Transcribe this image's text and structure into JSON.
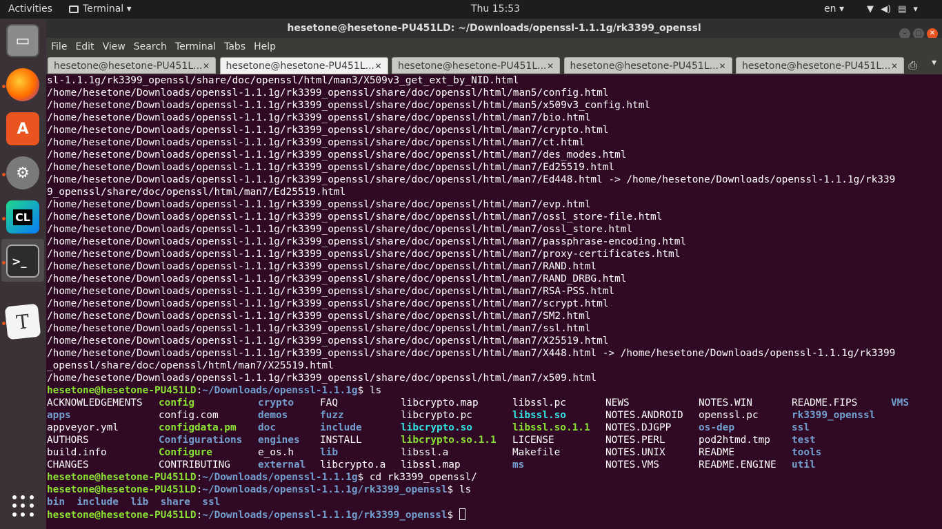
{
  "topbar": {
    "activities": "Activities",
    "app": "Terminal",
    "clock": "Thu 15:53",
    "language": "en",
    "icons": [
      "wifi-icon",
      "volume-icon",
      "clipboard-icon",
      "power-icon"
    ]
  },
  "dock": {
    "items": [
      "Files",
      "Firefox",
      "Ubuntu Software",
      "Settings",
      "CLion",
      "Terminal",
      "Typora"
    ],
    "show_apps": "Show Applications"
  },
  "window": {
    "title": "hesetone@hesetone-PU451LD: ~/Downloads/openssl-1.1.1g/rk3399_openssl",
    "menu": [
      "File",
      "Edit",
      "View",
      "Search",
      "Terminal",
      "Tabs",
      "Help"
    ],
    "tabs": [
      {
        "label": "hesetone@hesetone-PU451L...",
        "active": false
      },
      {
        "label": "hesetone@hesetone-PU451L...",
        "active": true
      },
      {
        "label": "hesetone@hesetone-PU451L...",
        "active": false
      },
      {
        "label": "hesetone@hesetone-PU451L...",
        "active": false
      },
      {
        "label": "hesetone@hesetone-PU451L...",
        "active": false
      }
    ]
  },
  "terminal": {
    "lines": [
      "sl-1.1.1g/rk3399_openssl/share/doc/openssl/html/man3/X509v3_get_ext_by_NID.html",
      "/home/hesetone/Downloads/openssl-1.1.1g/rk3399_openssl/share/doc/openssl/html/man5/config.html",
      "/home/hesetone/Downloads/openssl-1.1.1g/rk3399_openssl/share/doc/openssl/html/man5/x509v3_config.html",
      "/home/hesetone/Downloads/openssl-1.1.1g/rk3399_openssl/share/doc/openssl/html/man7/bio.html",
      "/home/hesetone/Downloads/openssl-1.1.1g/rk3399_openssl/share/doc/openssl/html/man7/crypto.html",
      "/home/hesetone/Downloads/openssl-1.1.1g/rk3399_openssl/share/doc/openssl/html/man7/ct.html",
      "/home/hesetone/Downloads/openssl-1.1.1g/rk3399_openssl/share/doc/openssl/html/man7/des_modes.html",
      "/home/hesetone/Downloads/openssl-1.1.1g/rk3399_openssl/share/doc/openssl/html/man7/Ed25519.html",
      "/home/hesetone/Downloads/openssl-1.1.1g/rk3399_openssl/share/doc/openssl/html/man7/Ed448.html -> /home/hesetone/Downloads/openssl-1.1.1g/rk339",
      "9_openssl/share/doc/openssl/html/man7/Ed25519.html",
      "/home/hesetone/Downloads/openssl-1.1.1g/rk3399_openssl/share/doc/openssl/html/man7/evp.html",
      "/home/hesetone/Downloads/openssl-1.1.1g/rk3399_openssl/share/doc/openssl/html/man7/ossl_store-file.html",
      "/home/hesetone/Downloads/openssl-1.1.1g/rk3399_openssl/share/doc/openssl/html/man7/ossl_store.html",
      "/home/hesetone/Downloads/openssl-1.1.1g/rk3399_openssl/share/doc/openssl/html/man7/passphrase-encoding.html",
      "/home/hesetone/Downloads/openssl-1.1.1g/rk3399_openssl/share/doc/openssl/html/man7/proxy-certificates.html",
      "/home/hesetone/Downloads/openssl-1.1.1g/rk3399_openssl/share/doc/openssl/html/man7/RAND.html",
      "/home/hesetone/Downloads/openssl-1.1.1g/rk3399_openssl/share/doc/openssl/html/man7/RAND_DRBG.html",
      "/home/hesetone/Downloads/openssl-1.1.1g/rk3399_openssl/share/doc/openssl/html/man7/RSA-PSS.html",
      "/home/hesetone/Downloads/openssl-1.1.1g/rk3399_openssl/share/doc/openssl/html/man7/scrypt.html",
      "/home/hesetone/Downloads/openssl-1.1.1g/rk3399_openssl/share/doc/openssl/html/man7/SM2.html",
      "/home/hesetone/Downloads/openssl-1.1.1g/rk3399_openssl/share/doc/openssl/html/man7/ssl.html",
      "/home/hesetone/Downloads/openssl-1.1.1g/rk3399_openssl/share/doc/openssl/html/man7/X25519.html",
      "/home/hesetone/Downloads/openssl-1.1.1g/rk3399_openssl/share/doc/openssl/html/man7/X448.html -> /home/hesetone/Downloads/openssl-1.1.1g/rk3399",
      "_openssl/share/doc/openssl/html/man7/X25519.html",
      "/home/hesetone/Downloads/openssl-1.1.1g/rk3399_openssl/share/doc/openssl/html/man7/x509.html"
    ],
    "prompt1": {
      "user": "hesetone@hesetone-PU451LD",
      "path": "~/Downloads/openssl-1.1.1g",
      "cmd": "$ ls"
    },
    "ls_rows": [
      [
        [
          "ACKNOWLEDGEMENTS",
          "f"
        ],
        [
          "config",
          "exe"
        ],
        [
          "crypto",
          "dir"
        ],
        [
          "FAQ",
          "f"
        ],
        [
          "libcrypto.map",
          "f"
        ],
        [
          "libssl.pc",
          "f"
        ],
        [
          "NEWS",
          "f"
        ],
        [
          "NOTES.WIN",
          "f"
        ],
        [
          "README.FIPS",
          "f"
        ],
        [
          "VMS",
          "dir"
        ]
      ],
      [
        [
          "apps",
          "dir"
        ],
        [
          "config.com",
          "f"
        ],
        [
          "demos",
          "dir"
        ],
        [
          "fuzz",
          "dir"
        ],
        [
          "libcrypto.pc",
          "f"
        ],
        [
          "libssl.so",
          "lnk"
        ],
        [
          "NOTES.ANDROID",
          "f"
        ],
        [
          "openssl.pc",
          "f"
        ],
        [
          "rk3399_openssl",
          "dir"
        ],
        [
          "",
          ""
        ]
      ],
      [
        [
          "appveyor.yml",
          "f"
        ],
        [
          "configdata.pm",
          "exe"
        ],
        [
          "doc",
          "dir"
        ],
        [
          "include",
          "dir"
        ],
        [
          "libcrypto.so",
          "lnk"
        ],
        [
          "libssl.so.1.1",
          "exe"
        ],
        [
          "NOTES.DJGPP",
          "f"
        ],
        [
          "os-dep",
          "dir"
        ],
        [
          "ssl",
          "dir"
        ],
        [
          "",
          ""
        ]
      ],
      [
        [
          "AUTHORS",
          "f"
        ],
        [
          "Configurations",
          "dir"
        ],
        [
          "engines",
          "dir"
        ],
        [
          "INSTALL",
          "f"
        ],
        [
          "libcrypto.so.1.1",
          "exe"
        ],
        [
          "LICENSE",
          "f"
        ],
        [
          "NOTES.PERL",
          "f"
        ],
        [
          "pod2htmd.tmp",
          "f"
        ],
        [
          "test",
          "dir"
        ],
        [
          "",
          ""
        ]
      ],
      [
        [
          "build.info",
          "f"
        ],
        [
          "Configure",
          "exe"
        ],
        [
          "e_os.h",
          "f"
        ],
        [
          "lib",
          "dir"
        ],
        [
          "libssl.a",
          "f"
        ],
        [
          "Makefile",
          "f"
        ],
        [
          "NOTES.UNIX",
          "f"
        ],
        [
          "README",
          "f"
        ],
        [
          "tools",
          "dir"
        ],
        [
          "",
          ""
        ]
      ],
      [
        [
          "CHANGES",
          "f"
        ],
        [
          "CONTRIBUTING",
          "f"
        ],
        [
          "external",
          "dir"
        ],
        [
          "libcrypto.a",
          "f"
        ],
        [
          "libssl.map",
          "f"
        ],
        [
          "ms",
          "dir"
        ],
        [
          "NOTES.VMS",
          "f"
        ],
        [
          "README.ENGINE",
          "f"
        ],
        [
          "util",
          "dir"
        ],
        [
          "",
          ""
        ]
      ]
    ],
    "prompt2": {
      "user": "hesetone@hesetone-PU451LD",
      "path": "~/Downloads/openssl-1.1.1g",
      "cmd": "$ cd rk3399_openssl/"
    },
    "prompt3": {
      "user": "hesetone@hesetone-PU451LD",
      "path": "~/Downloads/openssl-1.1.1g/rk3399_openssl",
      "cmd": "$ ls"
    },
    "ls2": [
      "bin",
      "include",
      "lib",
      "share",
      "ssl"
    ],
    "prompt4": {
      "user": "hesetone@hesetone-PU451LD",
      "path": "~/Downloads/openssl-1.1.1g/rk3399_openssl",
      "cmd": "$ "
    }
  },
  "colors": {
    "bg": "#300a24",
    "user": "#8ae234",
    "path": "#729fcf",
    "dir": "#729fcf",
    "exe": "#8ae234",
    "link": "#34e2e2",
    "accent": "#e95420"
  }
}
